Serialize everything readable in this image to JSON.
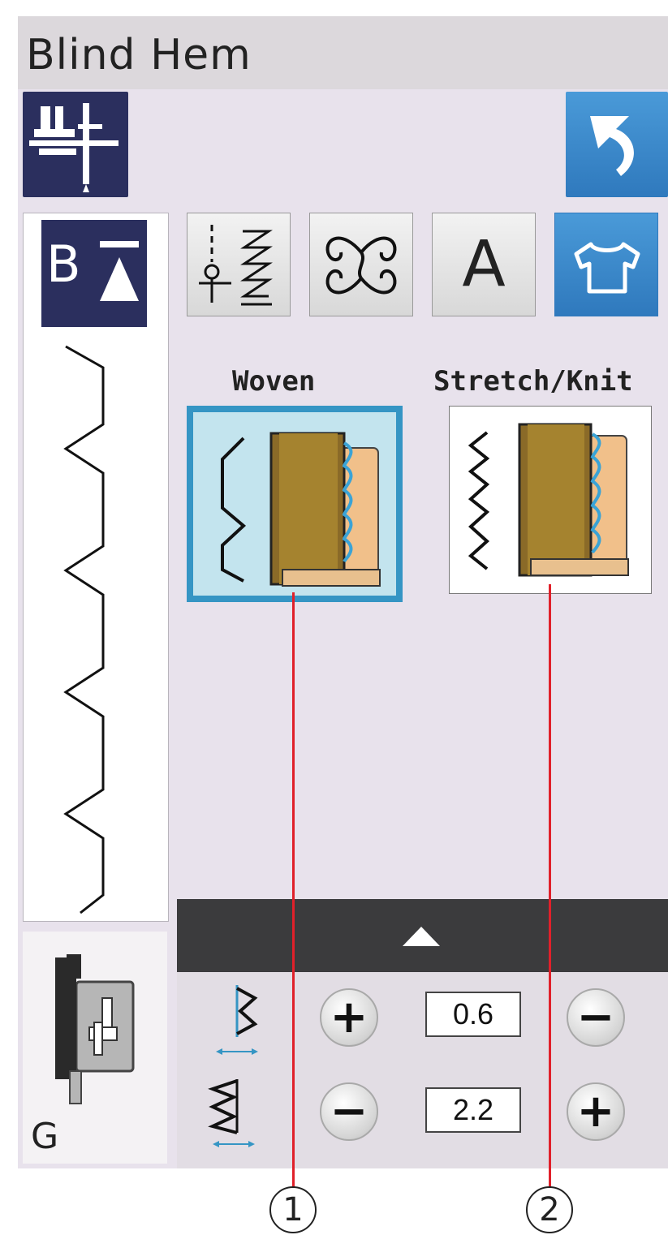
{
  "window": {
    "title": "Blind Hem"
  },
  "toolbar": {
    "foot_mode_icon": "presser-foot-needle-icon",
    "back_icon": "return-arrow-icon"
  },
  "pattern_panel": {
    "badge_letter": "B",
    "badge_icon": "bar-over-triangle-icon",
    "preview_icon": "blind-hem-stitch-preview"
  },
  "category_tabs": [
    {
      "icon": "utility-stitch-icon",
      "label": ""
    },
    {
      "icon": "decorative-stitch-icon",
      "label": ""
    },
    {
      "icon": "letter-icon",
      "label": "A"
    },
    {
      "icon": "garment-shirt-icon",
      "label": ""
    }
  ],
  "stitch_types": {
    "woven": {
      "label": "Woven",
      "selected": true
    },
    "stretch": {
      "label": "Stretch/Knit",
      "selected": false
    }
  },
  "adjust_bar": {
    "icon": "triangle-up-icon"
  },
  "settings": {
    "needle_position": {
      "icon": "stitch-width-icon",
      "value": "0.6",
      "left_btn": "+",
      "right_btn": "−"
    },
    "stitch_length": {
      "icon": "stitch-length-icon",
      "value": "2.2",
      "left_btn": "−",
      "right_btn": "+"
    }
  },
  "presser_foot": {
    "letter": "G",
    "icon": "presser-foot-g-icon"
  },
  "callouts": [
    "1",
    "2"
  ],
  "colors": {
    "accent_blue": "#3595c4",
    "dark_navy": "#2b2f5e",
    "callout_red": "#e0202a"
  }
}
